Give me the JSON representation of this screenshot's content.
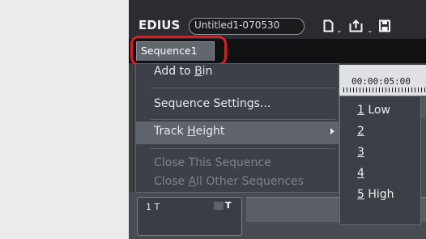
{
  "app": {
    "logo_text": "EDIUS",
    "project_name": "Untitled1-070530"
  },
  "toolbar": {
    "icons": [
      "new-project-icon",
      "open-project-icon",
      "save-project-icon"
    ],
    "dropdown_glyph": "⌄"
  },
  "tabs": {
    "sequence_tab": "Sequence1"
  },
  "timeline": {
    "timecode": "00:00:05:00",
    "track_name": "1 T",
    "track_type_glyph": "T"
  },
  "context_menu": {
    "items": [
      {
        "id": "add-to-bin",
        "pre": "Add to ",
        "key": "B",
        "post": "in",
        "enabled": true
      },
      {
        "id": "sequence-settings",
        "pre": "Sequence Settings...",
        "key": "",
        "post": "",
        "enabled": true
      },
      {
        "id": "track-height",
        "pre": "Track ",
        "key": "H",
        "post": "eight",
        "enabled": true,
        "has_submenu": true,
        "active": true
      },
      {
        "id": "close-this-sequence",
        "pre": "Close This Sequence",
        "key": "",
        "post": "",
        "enabled": false
      },
      {
        "id": "close-all-other-sequences",
        "pre": "Close ",
        "key": "A",
        "post": "ll Other Sequences",
        "enabled": false
      }
    ]
  },
  "submenu": {
    "items": [
      {
        "key": "1",
        "rest": " Low"
      },
      {
        "key": "2",
        "rest": ""
      },
      {
        "key": "3",
        "rest": ""
      },
      {
        "key": "4",
        "rest": ""
      },
      {
        "key": "5",
        "rest": " High"
      }
    ]
  },
  "colors": {
    "highlight_ring": "#d81e25",
    "menu_bg": "#3d4046",
    "menu_active": "#5f646c"
  }
}
